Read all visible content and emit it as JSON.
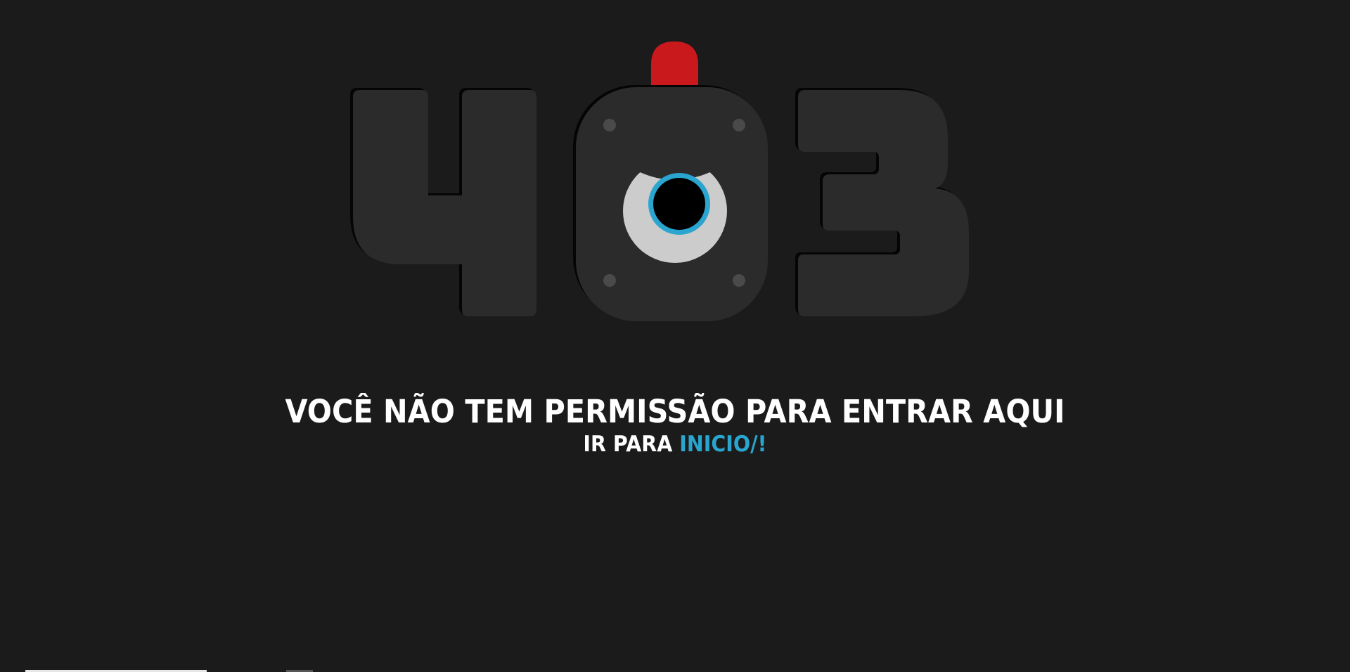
{
  "error": {
    "code_digits": [
      "4",
      "0",
      "3"
    ],
    "message": "VOCÊ NÃO TEM PERMISSÃO PARA ENTRAR AQUI",
    "link_prefix": "IR PARA ",
    "link_label": "INICIO/!"
  },
  "colors": {
    "background": "#1b1b1b",
    "digit_fill": "#2b2b2b",
    "digit_shadow": "#050505",
    "alarm_light": "#c9191d",
    "eye_white": "#cccccc",
    "iris": "#2aa5cf",
    "pupil": "#000000",
    "screw": "#4a4a4a",
    "text": "#ffffff",
    "link": "#2aa5cf"
  }
}
